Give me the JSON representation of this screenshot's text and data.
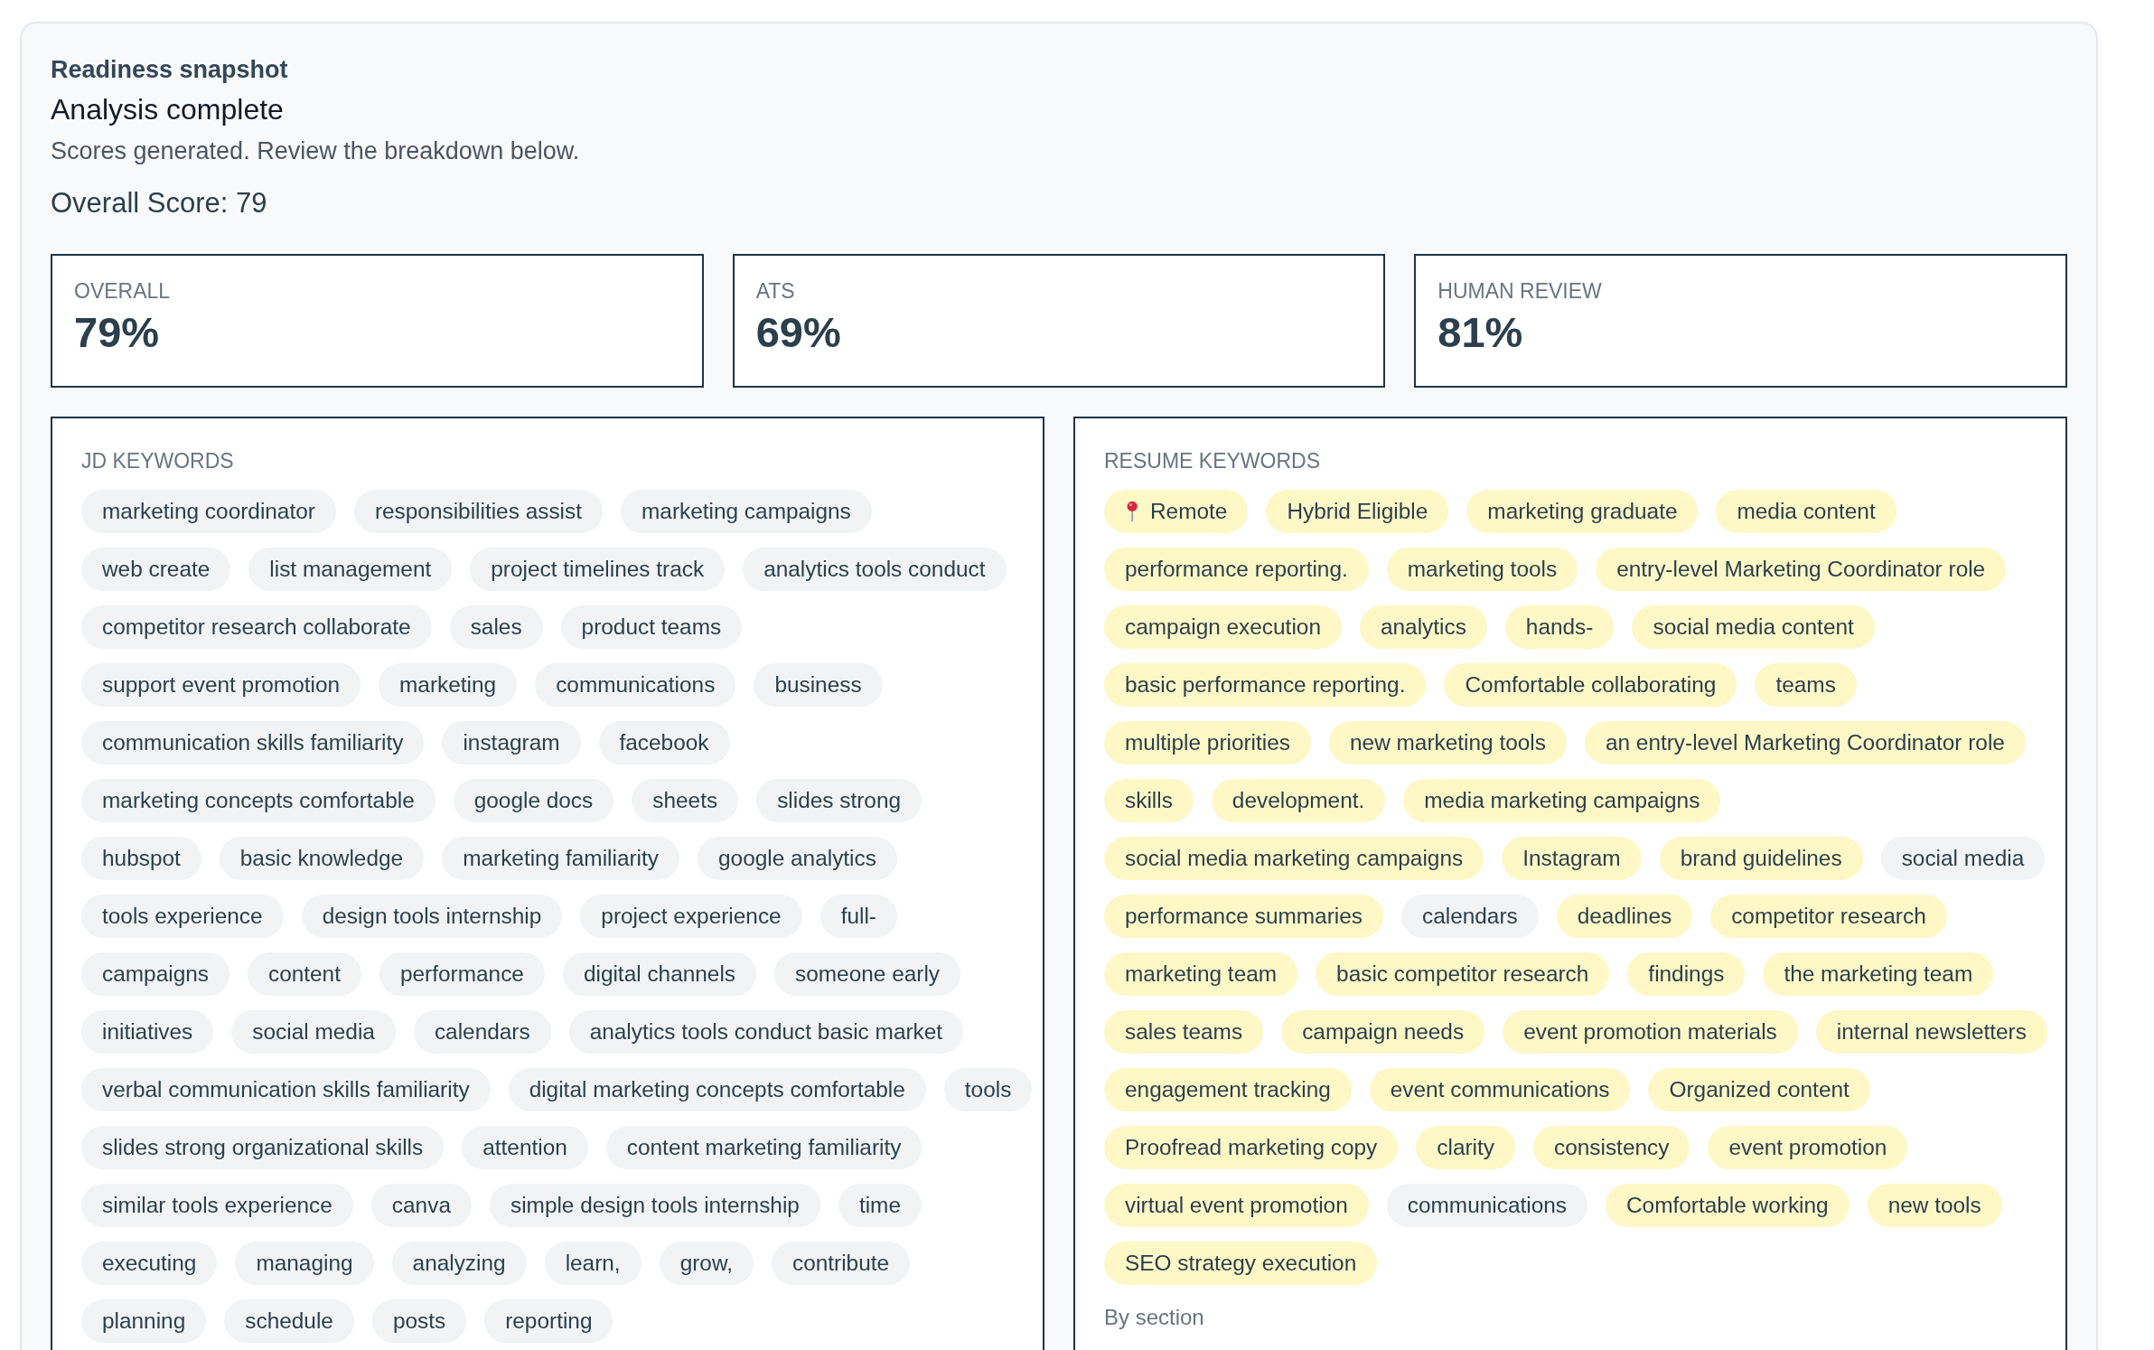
{
  "header": {
    "eyebrow": "Readiness snapshot",
    "title": "Analysis complete",
    "subtitle": "Scores generated. Review the breakdown below.",
    "overall": "Overall Score: 79"
  },
  "scores": [
    {
      "label": "OVERALL",
      "value": "79%"
    },
    {
      "label": "ATS",
      "value": "69%"
    },
    {
      "label": "HUMAN REVIEW",
      "value": "81%"
    }
  ],
  "jd_keywords": {
    "title": "JD KEYWORDS",
    "items": [
      "marketing coordinator",
      "responsibilities assist",
      "marketing campaigns",
      "web create",
      "list management",
      "project timelines track",
      "analytics tools conduct",
      "competitor research collaborate",
      "sales",
      "product teams",
      "support event promotion",
      "marketing",
      "communications",
      "business",
      "communication skills familiarity",
      "instagram",
      "facebook",
      "marketing concepts comfortable",
      "google docs",
      "sheets",
      "slides strong",
      "hubspot",
      "basic knowledge",
      "marketing familiarity",
      "google analytics",
      "tools experience",
      "design tools internship",
      "project experience",
      "full-",
      "campaigns",
      "content",
      "performance",
      "digital channels",
      "someone early",
      "initiatives",
      "social media",
      "calendars",
      "analytics tools conduct basic market",
      "verbal communication skills familiarity",
      "digital marketing concepts comfortable",
      "tools",
      "slides strong organizational skills",
      "attention",
      "content marketing familiarity",
      "similar tools experience",
      "canva",
      "simple design tools internship",
      "time",
      "executing",
      "managing",
      "analyzing",
      "learn,",
      "grow,",
      "contribute",
      "planning",
      "schedule",
      "posts",
      "reporting"
    ]
  },
  "resume_keywords": {
    "title": "RESUME KEYWORDS",
    "items": [
      {
        "text": "Remote",
        "kind": "location",
        "matched": true
      },
      {
        "text": "Hybrid Eligible",
        "kind": "keyword",
        "matched": true
      },
      {
        "text": "marketing graduate",
        "kind": "keyword",
        "matched": true
      },
      {
        "text": "media content",
        "kind": "keyword",
        "matched": true
      },
      {
        "text": "performance reporting.",
        "kind": "keyword",
        "matched": true
      },
      {
        "text": "marketing tools",
        "kind": "keyword",
        "matched": true
      },
      {
        "text": "entry-level Marketing Coordinator role",
        "kind": "keyword",
        "matched": true
      },
      {
        "text": "campaign execution",
        "kind": "keyword",
        "matched": true
      },
      {
        "text": "analytics",
        "kind": "keyword",
        "matched": true
      },
      {
        "text": "hands-",
        "kind": "keyword",
        "matched": true
      },
      {
        "text": "social media content",
        "kind": "keyword",
        "matched": true
      },
      {
        "text": "basic performance reporting.",
        "kind": "keyword",
        "matched": true
      },
      {
        "text": "Comfortable collaborating",
        "kind": "keyword",
        "matched": true
      },
      {
        "text": "teams",
        "kind": "keyword",
        "matched": true
      },
      {
        "text": "multiple priorities",
        "kind": "keyword",
        "matched": true
      },
      {
        "text": "new marketing tools",
        "kind": "keyword",
        "matched": true
      },
      {
        "text": "an entry-level Marketing Coordinator role",
        "kind": "keyword",
        "matched": true
      },
      {
        "text": "skills",
        "kind": "keyword",
        "matched": true
      },
      {
        "text": "development.",
        "kind": "keyword",
        "matched": true
      },
      {
        "text": "media marketing campaigns",
        "kind": "keyword",
        "matched": true
      },
      {
        "text": "social media marketing campaigns",
        "kind": "keyword",
        "matched": true
      },
      {
        "text": "Instagram",
        "kind": "keyword",
        "matched": true
      },
      {
        "text": "brand guidelines",
        "kind": "keyword",
        "matched": true
      },
      {
        "text": "social media",
        "kind": "keyword",
        "matched": false
      },
      {
        "text": "performance summaries",
        "kind": "keyword",
        "matched": true
      },
      {
        "text": "calendars",
        "kind": "keyword",
        "matched": false
      },
      {
        "text": "deadlines",
        "kind": "keyword",
        "matched": true
      },
      {
        "text": "competitor research",
        "kind": "keyword",
        "matched": true
      },
      {
        "text": "marketing team",
        "kind": "keyword",
        "matched": true
      },
      {
        "text": "basic competitor research",
        "kind": "keyword",
        "matched": true
      },
      {
        "text": "findings",
        "kind": "keyword",
        "matched": true
      },
      {
        "text": "the marketing team",
        "kind": "keyword",
        "matched": true
      },
      {
        "text": "sales teams",
        "kind": "keyword",
        "matched": true
      },
      {
        "text": "campaign needs",
        "kind": "keyword",
        "matched": true
      },
      {
        "text": "event promotion materials",
        "kind": "keyword",
        "matched": true
      },
      {
        "text": "internal newsletters",
        "kind": "keyword",
        "matched": true
      },
      {
        "text": "engagement tracking",
        "kind": "keyword",
        "matched": true
      },
      {
        "text": "event communications",
        "kind": "keyword",
        "matched": true
      },
      {
        "text": "Organized content",
        "kind": "keyword",
        "matched": true
      },
      {
        "text": "Proofread marketing copy",
        "kind": "keyword",
        "matched": true
      },
      {
        "text": "clarity",
        "kind": "keyword",
        "matched": true
      },
      {
        "text": "consistency",
        "kind": "keyword",
        "matched": true
      },
      {
        "text": "event promotion",
        "kind": "keyword",
        "matched": true
      },
      {
        "text": "virtual event promotion",
        "kind": "keyword",
        "matched": true
      },
      {
        "text": "communications",
        "kind": "keyword",
        "matched": false
      },
      {
        "text": "Comfortable working",
        "kind": "keyword",
        "matched": true
      },
      {
        "text": "new tools",
        "kind": "keyword",
        "matched": true
      },
      {
        "text": "SEO strategy execution",
        "kind": "keyword",
        "matched": true
      }
    ],
    "section_label": "By section"
  }
}
